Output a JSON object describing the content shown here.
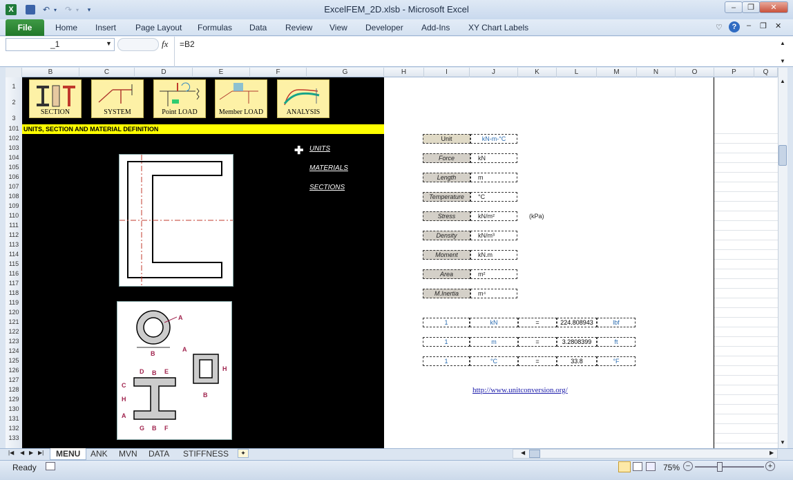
{
  "window": {
    "title": "ExcelFEM_2D.xlsb - Microsoft Excel"
  },
  "ribbon": {
    "file": "File",
    "tabs": [
      "Home",
      "Insert",
      "Page Layout",
      "Formulas",
      "Data",
      "Review",
      "View",
      "Developer",
      "Add-Ins",
      "XY Chart Labels"
    ]
  },
  "formula_bar": {
    "name_box": "_1",
    "fx": "fx",
    "formula": "=B2"
  },
  "columns": [
    "B",
    "C",
    "D",
    "E",
    "F",
    "G",
    "H",
    "I",
    "J",
    "K",
    "L",
    "M",
    "N",
    "O",
    "P",
    "Q"
  ],
  "rows": [
    "1",
    "2",
    "3",
    "101",
    "102",
    "103",
    "104",
    "105",
    "106",
    "107",
    "108",
    "109",
    "110",
    "111",
    "112",
    "113",
    "114",
    "115",
    "116",
    "117",
    "118",
    "119",
    "120",
    "121",
    "122",
    "123",
    "124",
    "125",
    "126",
    "127",
    "128",
    "129",
    "130",
    "131",
    "132",
    "133"
  ],
  "nav": {
    "section": "SECTION",
    "system": "SYSTEM",
    "point_load": "Point  LOAD",
    "member_load": "Member LOAD",
    "analysis": "ANALYSIS"
  },
  "header_bar": "UNITS, SECTION AND MATERIAL DEFINITION",
  "links": {
    "units": "UNITS",
    "materials": "MATERIALS",
    "sections": "SECTIONS"
  },
  "units_table": {
    "unit_label": "Unit",
    "unit_value": "kN-m-°C",
    "rows": [
      {
        "label": "Force",
        "value": "kN"
      },
      {
        "label": "Length",
        "value": "m"
      },
      {
        "label": "Temperature",
        "value": "°C"
      },
      {
        "label": "Stress",
        "value": "kN/m²"
      },
      {
        "label": "Density",
        "value": "kN/m³"
      },
      {
        "label": "Moment",
        "value": "kN.m"
      },
      {
        "label": "Area",
        "value": "m²"
      },
      {
        "label": "M.Inertia",
        "value": "m⁴"
      }
    ],
    "stress_note": "(kPa)"
  },
  "conversions": [
    {
      "q": "1",
      "u": "kN",
      "eq": "=",
      "v": "224.808943",
      "t": "lbf"
    },
    {
      "q": "1",
      "u": "m",
      "eq": "=",
      "v": "3.2808399",
      "t": "ft"
    },
    {
      "q": "1",
      "u": "°C",
      "eq": "=",
      "v": "33.8",
      "t": "°F"
    }
  ],
  "url": "http://www.unitconversion.org/",
  "sheet_tabs": [
    "MENU",
    "ANK",
    "MVN",
    "DATA",
    "STIFFNESS"
  ],
  "status": {
    "ready": "Ready",
    "zoom": "75%"
  },
  "diagram_labels": {
    "a": "A",
    "b": "B",
    "c": "C",
    "d": "D",
    "e": "E",
    "f": "F",
    "g": "G",
    "h": "H"
  }
}
